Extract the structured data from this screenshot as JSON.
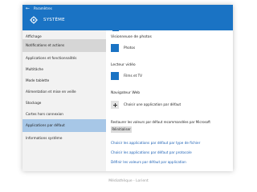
{
  "window": {
    "titlebar_text": "Paramètres",
    "header_title": "SYSTÈME"
  },
  "sidebar": {
    "items": [
      {
        "label": "Affichage"
      },
      {
        "label": "Notifications et actions"
      },
      {
        "label": "Applications et fonctionnalités"
      },
      {
        "label": "Multitâche"
      },
      {
        "label": "Mode tablette"
      },
      {
        "label": "Alimentation et mise en veille"
      },
      {
        "label": "Stockage"
      },
      {
        "label": "Cartes hors connexion"
      },
      {
        "label": "Applications par défaut"
      },
      {
        "label": "Informations système"
      }
    ]
  },
  "content": {
    "photo_viewer": {
      "heading": "Visionneuse de photos",
      "app": "Photos"
    },
    "video_player": {
      "heading": "Lecteur vidéo",
      "app": "Films et TV"
    },
    "web_browser": {
      "heading": "Navigateur Web",
      "app": "Choisir une application par défaut"
    },
    "reset": {
      "text": "Restaurer les valeurs par défaut recommandées par Microsoft",
      "button": "Réinitialiser"
    },
    "links": [
      "Choisir les applications par défaut par type de fichier",
      "Choisir les applications par défaut par protocole",
      "Définir les valeurs par défaut par application"
    ]
  },
  "footer": {
    "text": "Médiathèque - Lorient"
  }
}
